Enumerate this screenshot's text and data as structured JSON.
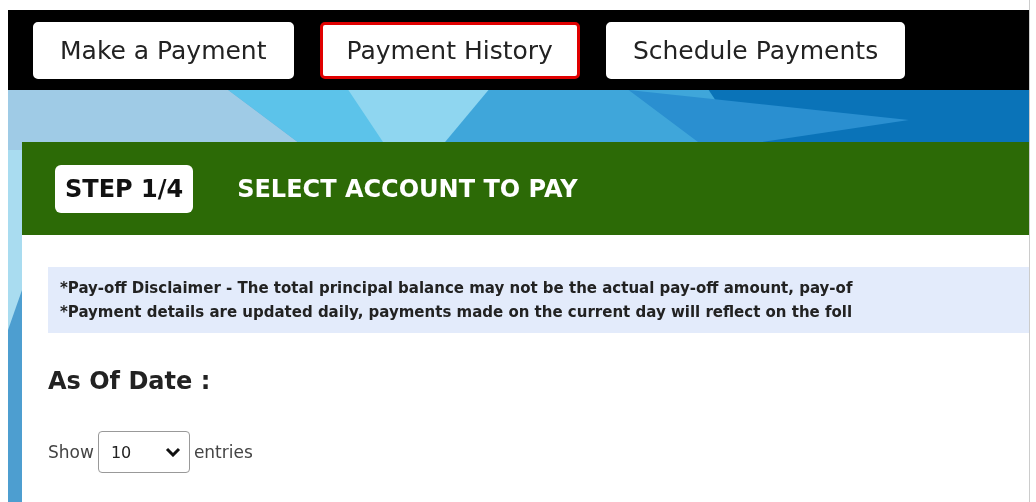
{
  "nav_tabs": [
    {
      "label": "Make a Payment",
      "selected": false
    },
    {
      "label": "Payment History",
      "selected": true
    },
    {
      "label": "Schedule Payments",
      "selected": false
    }
  ],
  "banner": {
    "kind": "picture"
  },
  "step": {
    "badge": "STEP 1/4",
    "title": "SELECT ACCOUNT TO PAY"
  },
  "disclaimer": [
    "*Pay-off Disclaimer - The total principal balance may not be the actual pay-off amount, pay-of",
    "*Payment details are updated daily, payments made on the current day will reflect on the foll"
  ],
  "as_of_date": {
    "label": "As Of Date :"
  },
  "entries": {
    "before": "Show",
    "value": "10",
    "after": "entries"
  }
}
